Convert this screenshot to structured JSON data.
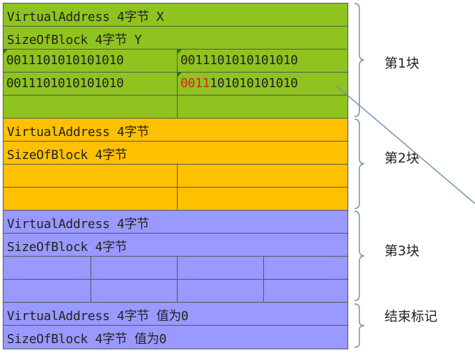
{
  "block1": {
    "row1": "VirtualAddress 4字节  X",
    "row2": "SizeOfBlock 4字节   Y",
    "cells": [
      "0011101010101010",
      "0011101010101010",
      "0011101010101010"
    ],
    "cell_red_prefix": "0011",
    "cell_red_rest": "101010101010",
    "label": "第1块"
  },
  "block2": {
    "row1": "VirtualAddress 4字节",
    "row2": "SizeOfBlock 4字节",
    "label": "第2块"
  },
  "block3": {
    "row1": "VirtualAddress 4字节",
    "row2": "SizeOfBlock 4字节",
    "label": "第3块"
  },
  "end": {
    "row1": "VirtualAddress 4字节 值为0",
    "row2": "SizeOfBlock 4字节  值为0",
    "label": "结束标记"
  },
  "colors": {
    "block1": "#8fc31f",
    "block2": "#ffc000",
    "block3": "#9999ff",
    "end": "#9999ff",
    "highlight": "#e02020",
    "arrow": "#7393b3"
  }
}
